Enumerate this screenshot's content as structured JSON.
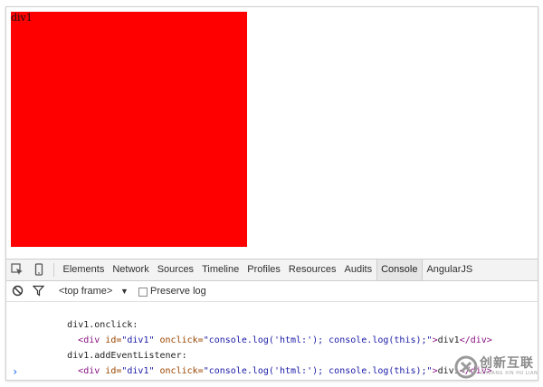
{
  "colors": {
    "div1_background": "#ff0000"
  },
  "page": {
    "div1_text": "div1"
  },
  "devtools": {
    "icons": [
      "inspect-element-icon",
      "device-mode-icon"
    ],
    "tabs": [
      {
        "label": "Elements"
      },
      {
        "label": "Network"
      },
      {
        "label": "Sources"
      },
      {
        "label": "Timeline"
      },
      {
        "label": "Profiles"
      },
      {
        "label": "Resources"
      },
      {
        "label": "Audits"
      },
      {
        "label": "Console",
        "active": true
      },
      {
        "label": "AngularJS"
      }
    ],
    "toolbar": {
      "frame_select": "<top frame>",
      "frame_arrow": "▼",
      "preserve_log_label": "Preserve log",
      "preserve_log_checked": false
    },
    "console": {
      "line1": "div1.onclick:",
      "line2": {
        "open_tag": "<div",
        "id_attr": "id=",
        "id_val": "\"div1\"",
        "onclick_attr": "onclick=",
        "onclick_val": "\"console.log('html:'); console.log(this);\"",
        "close_open": ">",
        "text": "div1",
        "close_tag": "</div>"
      },
      "line3": "div1.addEventListener:",
      "line4": {
        "open_tag": "<div",
        "id_attr": "id=",
        "id_val": "\"div1\"",
        "onclick_attr": "onclick=",
        "onclick_val": "\"console.log('html:'); console.log(this);\"",
        "close_open": ">",
        "text": "div1",
        "close_tag": "</div>"
      },
      "prompt": "›"
    }
  },
  "watermark": {
    "text": "创新互联",
    "sub": "CHUANG XIN HU LIAN"
  }
}
